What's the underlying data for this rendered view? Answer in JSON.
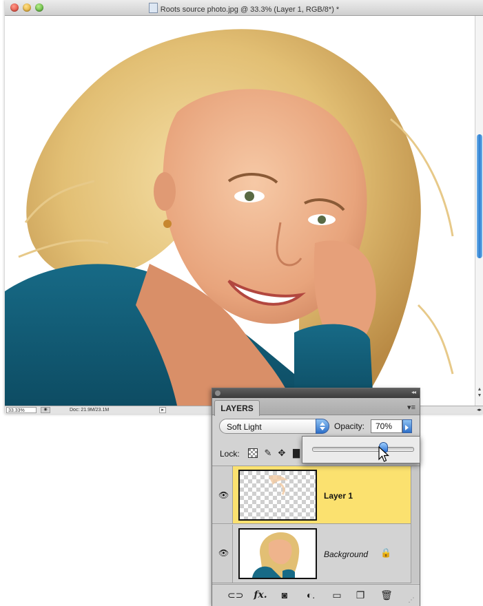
{
  "window": {
    "title": "Roots source photo.jpg @ 33.3% (Layer 1, RGB/8*) *"
  },
  "statusbar": {
    "zoom": "33.33%",
    "doc_size": "Doc: 21.9M/23.1M"
  },
  "layers_panel": {
    "tab_label": "LAYERS",
    "blend_mode": "Soft Light",
    "opacity_label": "Opacity:",
    "opacity_value": "70%",
    "opacity_slider_fraction": 0.7,
    "lock_label": "Lock:",
    "layers": [
      {
        "name": "Layer 1",
        "visible": true,
        "selected": true
      },
      {
        "name": "Background",
        "visible": true,
        "selected": false,
        "locked": true
      }
    ],
    "highlight_color": "#fbe16f"
  },
  "icons": {
    "eye": "eye-icon",
    "lock": "lock-icon",
    "link": "link-layers-icon",
    "fx": "fx",
    "mask": "add-mask-icon",
    "adjustment": "adjustment-layer-icon",
    "group": "folder-icon",
    "new_layer": "new-layer-icon",
    "trash": "trash-icon"
  }
}
